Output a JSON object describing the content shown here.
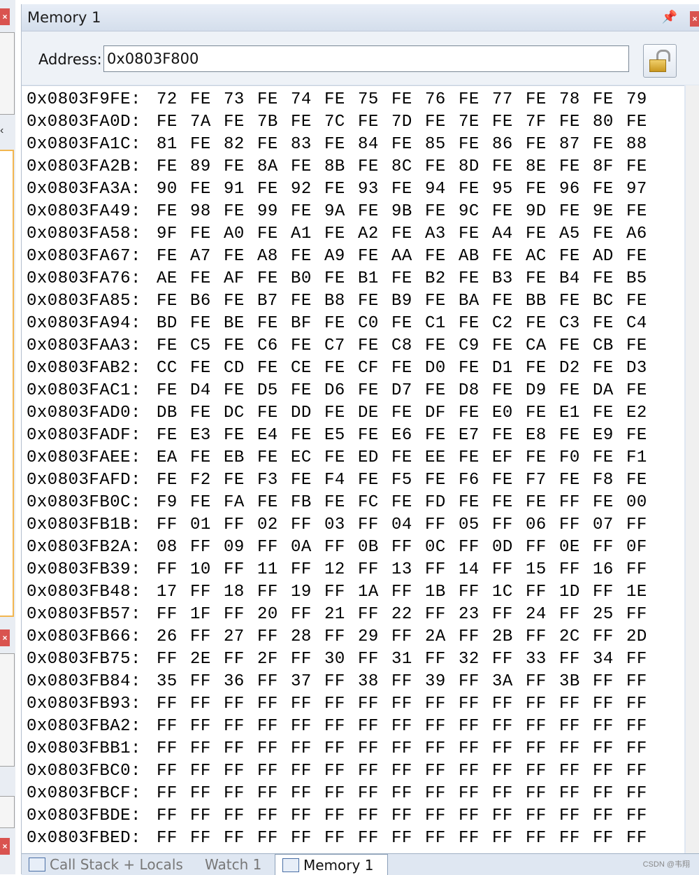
{
  "window": {
    "title": "Memory 1"
  },
  "toolbar": {
    "address_label": "Address:",
    "address_value": "0x0803F800"
  },
  "memory_rows": [
    {
      "address": "0x0803F9FE:",
      "bytes": [
        "72",
        "FE",
        "73",
        "FE",
        "74",
        "FE",
        "75",
        "FE",
        "76",
        "FE",
        "77",
        "FE",
        "78",
        "FE",
        "79"
      ]
    },
    {
      "address": "0x0803FA0D:",
      "bytes": [
        "FE",
        "7A",
        "FE",
        "7B",
        "FE",
        "7C",
        "FE",
        "7D",
        "FE",
        "7E",
        "FE",
        "7F",
        "FE",
        "80",
        "FE"
      ]
    },
    {
      "address": "0x0803FA1C:",
      "bytes": [
        "81",
        "FE",
        "82",
        "FE",
        "83",
        "FE",
        "84",
        "FE",
        "85",
        "FE",
        "86",
        "FE",
        "87",
        "FE",
        "88"
      ]
    },
    {
      "address": "0x0803FA2B:",
      "bytes": [
        "FE",
        "89",
        "FE",
        "8A",
        "FE",
        "8B",
        "FE",
        "8C",
        "FE",
        "8D",
        "FE",
        "8E",
        "FE",
        "8F",
        "FE"
      ]
    },
    {
      "address": "0x0803FA3A:",
      "bytes": [
        "90",
        "FE",
        "91",
        "FE",
        "92",
        "FE",
        "93",
        "FE",
        "94",
        "FE",
        "95",
        "FE",
        "96",
        "FE",
        "97"
      ]
    },
    {
      "address": "0x0803FA49:",
      "bytes": [
        "FE",
        "98",
        "FE",
        "99",
        "FE",
        "9A",
        "FE",
        "9B",
        "FE",
        "9C",
        "FE",
        "9D",
        "FE",
        "9E",
        "FE"
      ]
    },
    {
      "address": "0x0803FA58:",
      "bytes": [
        "9F",
        "FE",
        "A0",
        "FE",
        "A1",
        "FE",
        "A2",
        "FE",
        "A3",
        "FE",
        "A4",
        "FE",
        "A5",
        "FE",
        "A6"
      ]
    },
    {
      "address": "0x0803FA67:",
      "bytes": [
        "FE",
        "A7",
        "FE",
        "A8",
        "FE",
        "A9",
        "FE",
        "AA",
        "FE",
        "AB",
        "FE",
        "AC",
        "FE",
        "AD",
        "FE"
      ]
    },
    {
      "address": "0x0803FA76:",
      "bytes": [
        "AE",
        "FE",
        "AF",
        "FE",
        "B0",
        "FE",
        "B1",
        "FE",
        "B2",
        "FE",
        "B3",
        "FE",
        "B4",
        "FE",
        "B5"
      ]
    },
    {
      "address": "0x0803FA85:",
      "bytes": [
        "FE",
        "B6",
        "FE",
        "B7",
        "FE",
        "B8",
        "FE",
        "B9",
        "FE",
        "BA",
        "FE",
        "BB",
        "FE",
        "BC",
        "FE"
      ]
    },
    {
      "address": "0x0803FA94:",
      "bytes": [
        "BD",
        "FE",
        "BE",
        "FE",
        "BF",
        "FE",
        "C0",
        "FE",
        "C1",
        "FE",
        "C2",
        "FE",
        "C3",
        "FE",
        "C4"
      ]
    },
    {
      "address": "0x0803FAA3:",
      "bytes": [
        "FE",
        "C5",
        "FE",
        "C6",
        "FE",
        "C7",
        "FE",
        "C8",
        "FE",
        "C9",
        "FE",
        "CA",
        "FE",
        "CB",
        "FE"
      ]
    },
    {
      "address": "0x0803FAB2:",
      "bytes": [
        "CC",
        "FE",
        "CD",
        "FE",
        "CE",
        "FE",
        "CF",
        "FE",
        "D0",
        "FE",
        "D1",
        "FE",
        "D2",
        "FE",
        "D3"
      ]
    },
    {
      "address": "0x0803FAC1:",
      "bytes": [
        "FE",
        "D4",
        "FE",
        "D5",
        "FE",
        "D6",
        "FE",
        "D7",
        "FE",
        "D8",
        "FE",
        "D9",
        "FE",
        "DA",
        "FE"
      ]
    },
    {
      "address": "0x0803FAD0:",
      "bytes": [
        "DB",
        "FE",
        "DC",
        "FE",
        "DD",
        "FE",
        "DE",
        "FE",
        "DF",
        "FE",
        "E0",
        "FE",
        "E1",
        "FE",
        "E2"
      ]
    },
    {
      "address": "0x0803FADF:",
      "bytes": [
        "FE",
        "E3",
        "FE",
        "E4",
        "FE",
        "E5",
        "FE",
        "E6",
        "FE",
        "E7",
        "FE",
        "E8",
        "FE",
        "E9",
        "FE"
      ]
    },
    {
      "address": "0x0803FAEE:",
      "bytes": [
        "EA",
        "FE",
        "EB",
        "FE",
        "EC",
        "FE",
        "ED",
        "FE",
        "EE",
        "FE",
        "EF",
        "FE",
        "F0",
        "FE",
        "F1"
      ]
    },
    {
      "address": "0x0803FAFD:",
      "bytes": [
        "FE",
        "F2",
        "FE",
        "F3",
        "FE",
        "F4",
        "FE",
        "F5",
        "FE",
        "F6",
        "FE",
        "F7",
        "FE",
        "F8",
        "FE"
      ]
    },
    {
      "address": "0x0803FB0C:",
      "bytes": [
        "F9",
        "FE",
        "FA",
        "FE",
        "FB",
        "FE",
        "FC",
        "FE",
        "FD",
        "FE",
        "FE",
        "FE",
        "FF",
        "FE",
        "00"
      ]
    },
    {
      "address": "0x0803FB1B:",
      "bytes": [
        "FF",
        "01",
        "FF",
        "02",
        "FF",
        "03",
        "FF",
        "04",
        "FF",
        "05",
        "FF",
        "06",
        "FF",
        "07",
        "FF"
      ]
    },
    {
      "address": "0x0803FB2A:",
      "bytes": [
        "08",
        "FF",
        "09",
        "FF",
        "0A",
        "FF",
        "0B",
        "FF",
        "0C",
        "FF",
        "0D",
        "FF",
        "0E",
        "FF",
        "0F"
      ]
    },
    {
      "address": "0x0803FB39:",
      "bytes": [
        "FF",
        "10",
        "FF",
        "11",
        "FF",
        "12",
        "FF",
        "13",
        "FF",
        "14",
        "FF",
        "15",
        "FF",
        "16",
        "FF"
      ]
    },
    {
      "address": "0x0803FB48:",
      "bytes": [
        "17",
        "FF",
        "18",
        "FF",
        "19",
        "FF",
        "1A",
        "FF",
        "1B",
        "FF",
        "1C",
        "FF",
        "1D",
        "FF",
        "1E"
      ]
    },
    {
      "address": "0x0803FB57:",
      "bytes": [
        "FF",
        "1F",
        "FF",
        "20",
        "FF",
        "21",
        "FF",
        "22",
        "FF",
        "23",
        "FF",
        "24",
        "FF",
        "25",
        "FF"
      ]
    },
    {
      "address": "0x0803FB66:",
      "bytes": [
        "26",
        "FF",
        "27",
        "FF",
        "28",
        "FF",
        "29",
        "FF",
        "2A",
        "FF",
        "2B",
        "FF",
        "2C",
        "FF",
        "2D"
      ]
    },
    {
      "address": "0x0803FB75:",
      "bytes": [
        "FF",
        "2E",
        "FF",
        "2F",
        "FF",
        "30",
        "FF",
        "31",
        "FF",
        "32",
        "FF",
        "33",
        "FF",
        "34",
        "FF"
      ]
    },
    {
      "address": "0x0803FB84:",
      "bytes": [
        "35",
        "FF",
        "36",
        "FF",
        "37",
        "FF",
        "38",
        "FF",
        "39",
        "FF",
        "3A",
        "FF",
        "3B",
        "FF",
        "FF"
      ]
    },
    {
      "address": "0x0803FB93:",
      "bytes": [
        "FF",
        "FF",
        "FF",
        "FF",
        "FF",
        "FF",
        "FF",
        "FF",
        "FF",
        "FF",
        "FF",
        "FF",
        "FF",
        "FF",
        "FF"
      ]
    },
    {
      "address": "0x0803FBA2:",
      "bytes": [
        "FF",
        "FF",
        "FF",
        "FF",
        "FF",
        "FF",
        "FF",
        "FF",
        "FF",
        "FF",
        "FF",
        "FF",
        "FF",
        "FF",
        "FF"
      ]
    },
    {
      "address": "0x0803FBB1:",
      "bytes": [
        "FF",
        "FF",
        "FF",
        "FF",
        "FF",
        "FF",
        "FF",
        "FF",
        "FF",
        "FF",
        "FF",
        "FF",
        "FF",
        "FF",
        "FF"
      ]
    },
    {
      "address": "0x0803FBC0:",
      "bytes": [
        "FF",
        "FF",
        "FF",
        "FF",
        "FF",
        "FF",
        "FF",
        "FF",
        "FF",
        "FF",
        "FF",
        "FF",
        "FF",
        "FF",
        "FF"
      ]
    },
    {
      "address": "0x0803FBCF:",
      "bytes": [
        "FF",
        "FF",
        "FF",
        "FF",
        "FF",
        "FF",
        "FF",
        "FF",
        "FF",
        "FF",
        "FF",
        "FF",
        "FF",
        "FF",
        "FF"
      ]
    },
    {
      "address": "0x0803FBDE:",
      "bytes": [
        "FF",
        "FF",
        "FF",
        "FF",
        "FF",
        "FF",
        "FF",
        "FF",
        "FF",
        "FF",
        "FF",
        "FF",
        "FF",
        "FF",
        "FF"
      ]
    },
    {
      "address": "0x0803FBED:",
      "bytes": [
        "FF",
        "FF",
        "FF",
        "FF",
        "FF",
        "FF",
        "FF",
        "FF",
        "FF",
        "FF",
        "FF",
        "FF",
        "FF",
        "FF",
        "FF"
      ]
    }
  ],
  "tabs": [
    {
      "label": "Call Stack + Locals",
      "icon": "call-stack-icon",
      "active": false
    },
    {
      "label": "Watch 1",
      "icon": "",
      "active": false
    },
    {
      "label": "Memory 1",
      "icon": "memory-grid-icon",
      "active": true
    }
  ],
  "watermark": "CSDN @韦翔",
  "colors": {
    "accent_close": "#d9534f",
    "window_bg": "#dfe7f2",
    "highlight_border": "#f2b650"
  }
}
